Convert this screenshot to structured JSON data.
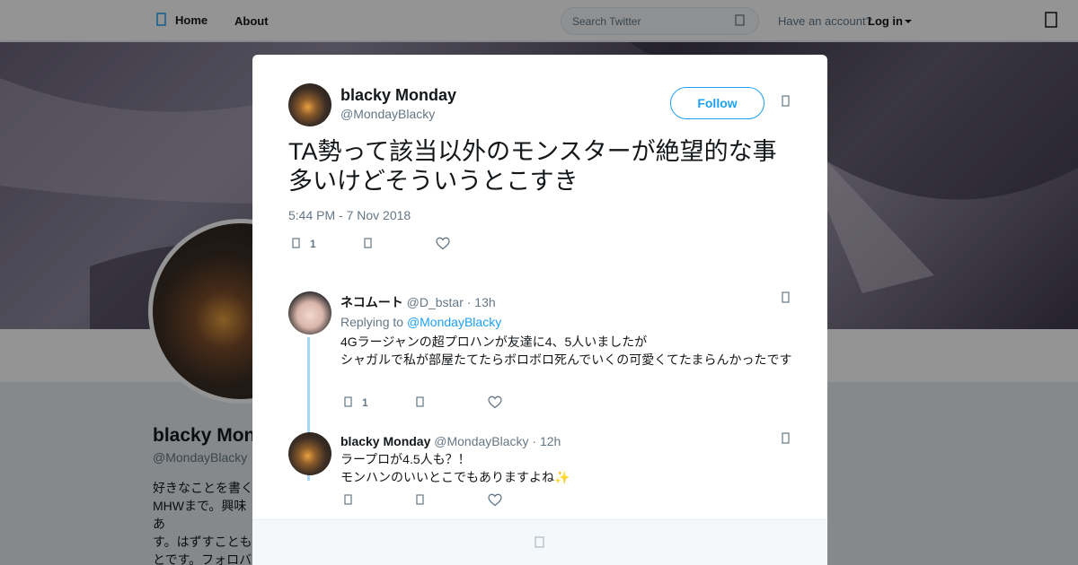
{
  "nav": {
    "home_label": "Home",
    "about_label": "About",
    "search_placeholder": "Search Twitter",
    "have_account": "Have an account?",
    "login_label": "Log in"
  },
  "profile": {
    "name": "blacky Monday",
    "name_visible": "blacky Mon",
    "handle": "@MondayBlacky",
    "bio": "好きなことを書く\nMHWまで。興味あ\nす。はずすことも\nとです。フォロバ\nあると嬉しかった"
  },
  "tweet": {
    "author_name": "blacky Monday",
    "author_handle": "@MondayBlacky",
    "follow_label": "Follow",
    "text": "TA勢って該当以外のモンスターが絶望的な事多いけどそういうとこすき",
    "timestamp": "5:44 PM - 7 Nov 2018",
    "reply_count": "1"
  },
  "replies": [
    {
      "name": "ネコムート",
      "handle": "@D_bstar",
      "time": "· 13h",
      "replying_prefix": "Replying to",
      "replying_to": "@MondayBlacky",
      "line1": "4Gラージャンの超プロハンが友達に4、5人いましたが",
      "line2": "シャガルで私が部屋たてたらボロボロ死んでいくの可愛くてたまらんかったです",
      "reply_count": "1"
    },
    {
      "name": "blacky Monday",
      "handle": "@MondayBlacky",
      "time": "· 12h",
      "line1": "ラープロが4.5人も？！",
      "line2": "モンハンのいいとこでもありますよね✨"
    }
  ],
  "colors": {
    "accent": "#1da1f2",
    "text": "#14171a",
    "muted": "#657786",
    "thread_line": "#a8d8f5"
  },
  "icons": [
    "twitter-home-icon",
    "search-icon",
    "caret-down-icon",
    "compose-icon",
    "chevron-down-icon",
    "reply-icon",
    "retweet-icon",
    "heart-icon",
    "more-icon"
  ]
}
